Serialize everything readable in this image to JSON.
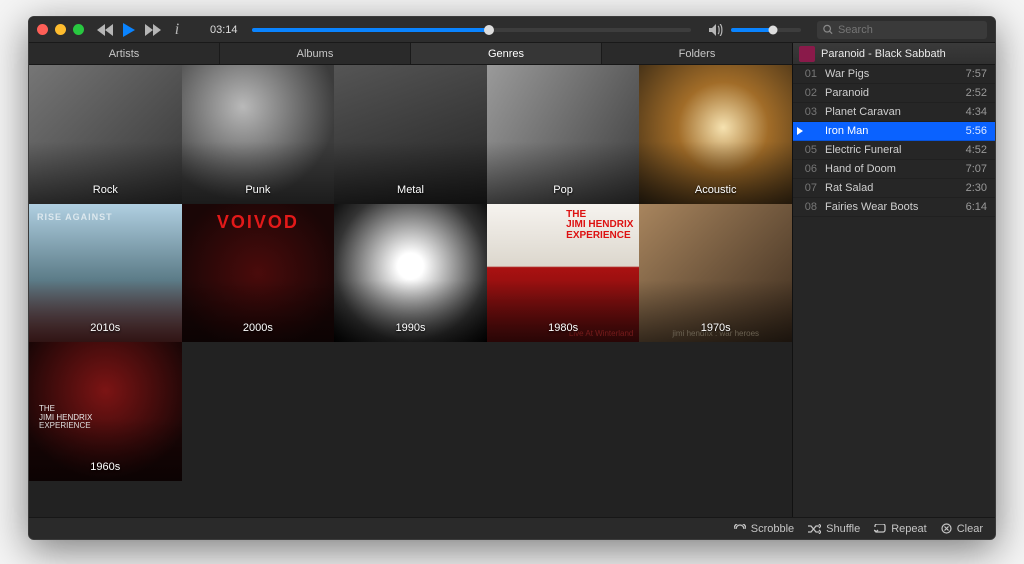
{
  "playback": {
    "current_time": "03:14",
    "seek_percent": 54,
    "volume_percent": 60
  },
  "search": {
    "placeholder": "Search"
  },
  "tabs": [
    {
      "label": "Artists",
      "active": false
    },
    {
      "label": "Albums",
      "active": false
    },
    {
      "label": "Genres",
      "active": true
    },
    {
      "label": "Folders",
      "active": false
    }
  ],
  "grid": [
    {
      "label": "Rock",
      "bg": "bg-mono"
    },
    {
      "label": "Punk",
      "bg": "bg-mono2"
    },
    {
      "label": "Metal",
      "bg": "bg-mono3"
    },
    {
      "label": "Pop",
      "bg": "bg-mono4"
    },
    {
      "label": "Acoustic",
      "bg": "bg-warm"
    },
    {
      "label": "2010s",
      "bg": "bg-rise",
      "overlay": "rise",
      "overlay_text": "RISE AGAINST"
    },
    {
      "label": "2000s",
      "bg": "bg-voivod",
      "overlay": "voivod",
      "overlay_text": "VOIVOD"
    },
    {
      "label": "1990s",
      "bg": "bg-white90"
    },
    {
      "label": "1980s",
      "bg": "bg-hendrix",
      "overlay": "hendrix",
      "overlay_text": "THE\nJIMI HENDRIX\nEXPERIENCE",
      "sub_text": "Live At Winterland"
    },
    {
      "label": "1970s",
      "bg": "bg-sepia",
      "caption": "jimi hendrix : war heroes"
    },
    {
      "label": "1960s",
      "bg": "bg-hendrix2",
      "overlay": "hxp",
      "overlay_text": "THE\nJIMI HENDRIX\nEXPERIENCE"
    }
  ],
  "now_playing": {
    "title": "Paranoid - Black Sabbath"
  },
  "tracks": [
    {
      "n": "01",
      "title": "War Pigs",
      "dur": "7:57",
      "active": false
    },
    {
      "n": "02",
      "title": "Paranoid",
      "dur": "2:52",
      "active": false
    },
    {
      "n": "03",
      "title": "Planet Caravan",
      "dur": "4:34",
      "active": false
    },
    {
      "n": "",
      "title": "Iron Man",
      "dur": "5:56",
      "active": true
    },
    {
      "n": "05",
      "title": "Electric Funeral",
      "dur": "4:52",
      "active": false
    },
    {
      "n": "06",
      "title": "Hand of Doom",
      "dur": "7:07",
      "active": false
    },
    {
      "n": "07",
      "title": "Rat Salad",
      "dur": "2:30",
      "active": false
    },
    {
      "n": "08",
      "title": "Fairies Wear Boots",
      "dur": "6:14",
      "active": false
    }
  ],
  "footer": {
    "scrobble": "Scrobble",
    "shuffle": "Shuffle",
    "repeat": "Repeat",
    "clear": "Clear"
  }
}
